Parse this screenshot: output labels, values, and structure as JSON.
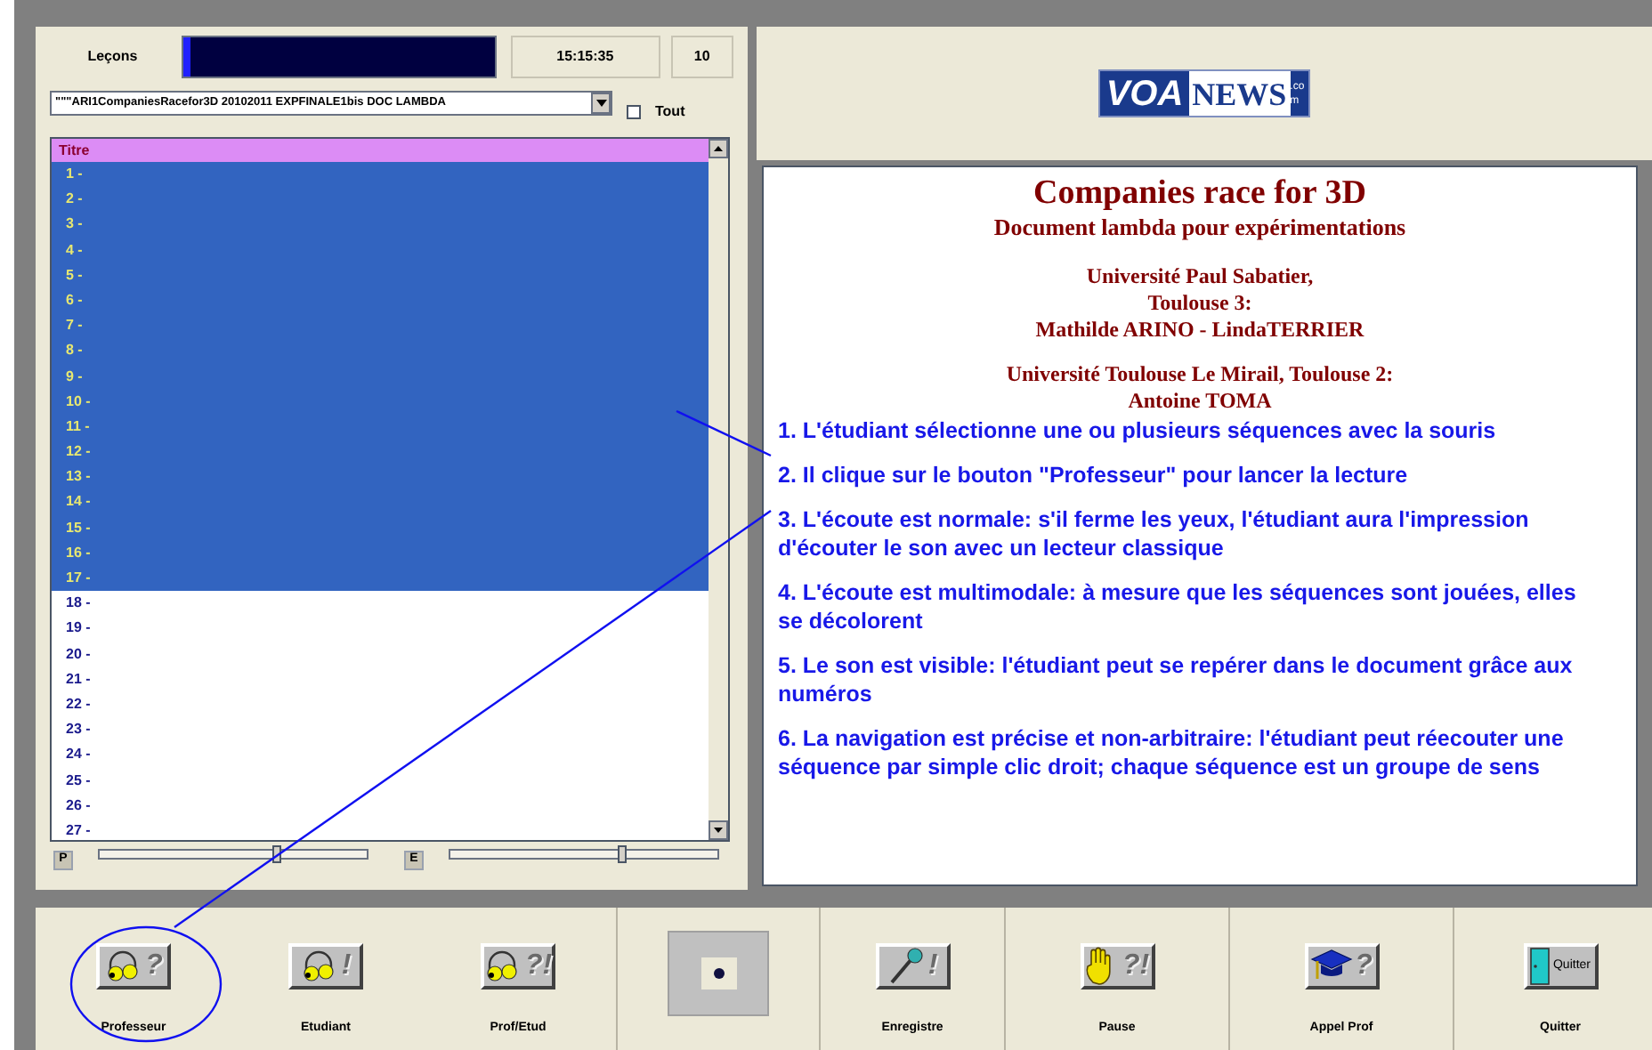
{
  "header": {
    "label": "Leçons",
    "progress": {
      "level": 0.02
    },
    "time": "15:15:35",
    "count": "10"
  },
  "lesson_select": {
    "value": "\"\"\"ARI1CompaniesRacefor3D 20102011 EXPFINALE1bis DOC LAMBDA"
  },
  "show_all": {
    "label": "Tout",
    "checked": false
  },
  "list": {
    "column": "Titre",
    "rows": [
      {
        "label": "1 -",
        "selected": true
      },
      {
        "label": "2 -",
        "selected": true
      },
      {
        "label": "3 -",
        "selected": true
      },
      {
        "label": "4 -",
        "selected": true
      },
      {
        "label": "5 -",
        "selected": true
      },
      {
        "label": "6 -",
        "selected": true
      },
      {
        "label": "7 -",
        "selected": true
      },
      {
        "label": "8 -",
        "selected": true
      },
      {
        "label": "9 -",
        "selected": true
      },
      {
        "label": "10 -",
        "selected": true
      },
      {
        "label": "11 -",
        "selected": true
      },
      {
        "label": "12 -",
        "selected": true
      },
      {
        "label": "13 -",
        "selected": true
      },
      {
        "label": "14 -",
        "selected": true
      },
      {
        "label": "15 -",
        "selected": true
      },
      {
        "label": "16 -",
        "selected": true
      },
      {
        "label": "17 -",
        "selected": true
      },
      {
        "label": "18 -",
        "selected": false
      },
      {
        "label": "19 -",
        "selected": false
      },
      {
        "label": "20 -",
        "selected": false
      },
      {
        "label": "21 -",
        "selected": false
      },
      {
        "label": "22 -",
        "selected": false
      },
      {
        "label": "23 -",
        "selected": false
      },
      {
        "label": "24 -",
        "selected": false
      },
      {
        "label": "25 -",
        "selected": false
      },
      {
        "label": "26 -",
        "selected": false
      },
      {
        "label": "27 -",
        "selected": false
      }
    ]
  },
  "sliders": [
    {
      "label": "P",
      "level": 0.66
    },
    {
      "label": "E",
      "level": 0.64
    }
  ],
  "logo": {
    "part_1": "VOA",
    "part_2": "NEWS",
    "part_3": ".com"
  },
  "document": {
    "title": "Companies race for 3D",
    "subtitle": "Document lambda pour expérimentations",
    "credits": [
      [
        "Université Paul Sabatier,",
        "Toulouse 3:",
        "Mathilde ARINO - LindaTERRIER"
      ],
      [
        "Université Toulouse Le Mirail, Toulouse 2:",
        "Antoine TOMA"
      ]
    ],
    "notes": [
      "1. L'étudiant sélectionne une ou plusieurs séquences avec la souris",
      "2. Il clique sur le bouton \"Professeur\" pour lancer la lecture",
      "3. L'écoute est normale: s'il ferme les yeux, l'étudiant aura l'impression d'écouter le son avec un lecteur classique",
      "4. L'écoute est multimodale: à mesure que les séquences sont jouées, elles se décolorent",
      "5. Le son est visible: l'étudiant peut se repérer dans le document grâce aux numéros",
      "6. La navigation est précise et non-arbitraire: l'étudiant peut réecouter une séquence par simple clic droit; chaque séquence est un groupe de sens"
    ]
  },
  "toolbar": [
    {
      "kind": "headphones",
      "mark": "?",
      "label": "Professeur"
    },
    {
      "kind": "headphones",
      "mark": "!",
      "label": "Etudiant"
    },
    {
      "kind": "headphones",
      "mark": "?!",
      "label": "Prof/Etud"
    },
    {
      "kind": "indicator"
    },
    {
      "kind": "microphone",
      "mark": "!",
      "label": "Enregistre"
    },
    {
      "kind": "hand",
      "mark": "?!",
      "label": "Pause"
    },
    {
      "kind": "cap",
      "mark": "?",
      "label": "Appel Prof"
    },
    {
      "kind": "door",
      "button_text": "Quitter",
      "label": "Quitter"
    }
  ]
}
